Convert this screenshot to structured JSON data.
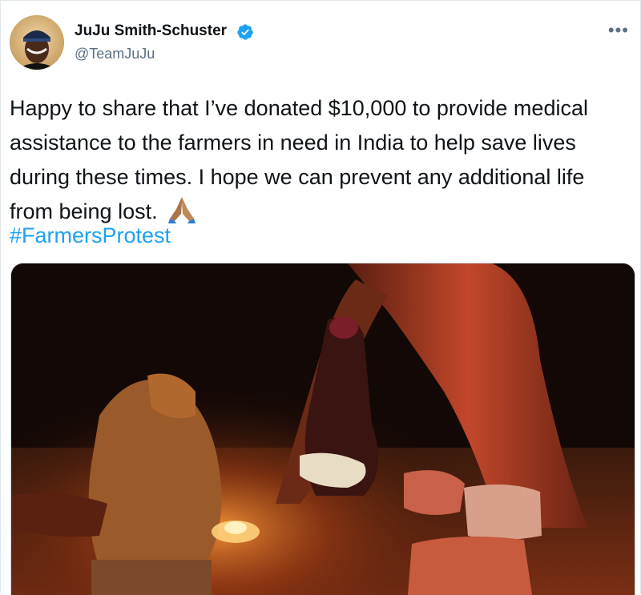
{
  "tweet": {
    "author": {
      "display_name": "JuJu Smith-Schuster",
      "handle": "@TeamJuJu",
      "verified": true
    },
    "text": "Happy to share that I’ve donated $10,000 to provide medical assistance to the farmers in need in India to help save lives during these times. I hope we can prevent any additional life from being lost.",
    "emoji": "🙏🏽",
    "hashtag": "#FarmersProtest",
    "more_icon": "more-horizontal-icon"
  },
  "colors": {
    "accent": "#1da1f2",
    "text": "#0f1419",
    "secondary": "#5b7083"
  }
}
